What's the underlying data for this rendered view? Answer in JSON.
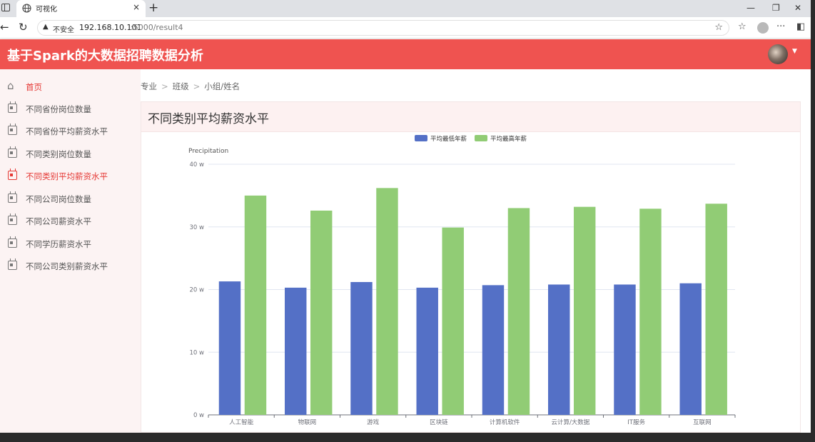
{
  "browser": {
    "tab_title": "可视化",
    "tab_close": "×",
    "new_tab": "+",
    "security_label": "不安全",
    "url_host": "192.168.10.101",
    "url_path": ":5000/result4"
  },
  "header": {
    "title": "基于Spark的大数据招聘数据分析"
  },
  "sidebar": {
    "items": [
      {
        "label": "首页"
      },
      {
        "label": "不同省份岗位数量"
      },
      {
        "label": "不同省份平均薪资水平"
      },
      {
        "label": "不同类别岗位数量"
      },
      {
        "label": "不同类别平均薪资水平"
      },
      {
        "label": "不同公司岗位数量"
      },
      {
        "label": "不同公司薪资水平"
      },
      {
        "label": "不同学历薪资水平"
      },
      {
        "label": "不同公司类别薪资水平"
      }
    ],
    "active_index": 4
  },
  "breadcrumb": [
    "专业",
    "班级",
    "小组/姓名"
  ],
  "card": {
    "title": "不同类别平均薪资水平"
  },
  "colors": {
    "accent": "#ef5350",
    "series_min": "#5470c6",
    "series_max": "#91cc75"
  },
  "chart_data": {
    "type": "bar",
    "ylabel": "Precipitation",
    "ylim": [
      0,
      40
    ],
    "yticks": [
      "0 w",
      "10 w",
      "20 w",
      "30 w",
      "40 w"
    ],
    "categories": [
      "人工智能",
      "物联网",
      "游戏",
      "区块链",
      "计算机软件",
      "云计算/大数据",
      "IT服务",
      "互联网"
    ],
    "series": [
      {
        "name": "平均最低年薪",
        "values": [
          21.3,
          20.3,
          21.2,
          20.3,
          20.7,
          20.8,
          20.8,
          21.0
        ]
      },
      {
        "name": "平均最高年薪",
        "values": [
          35.0,
          32.6,
          36.2,
          29.9,
          33.0,
          33.2,
          32.9,
          33.7
        ]
      }
    ],
    "legend": "top-center",
    "grid": true
  }
}
